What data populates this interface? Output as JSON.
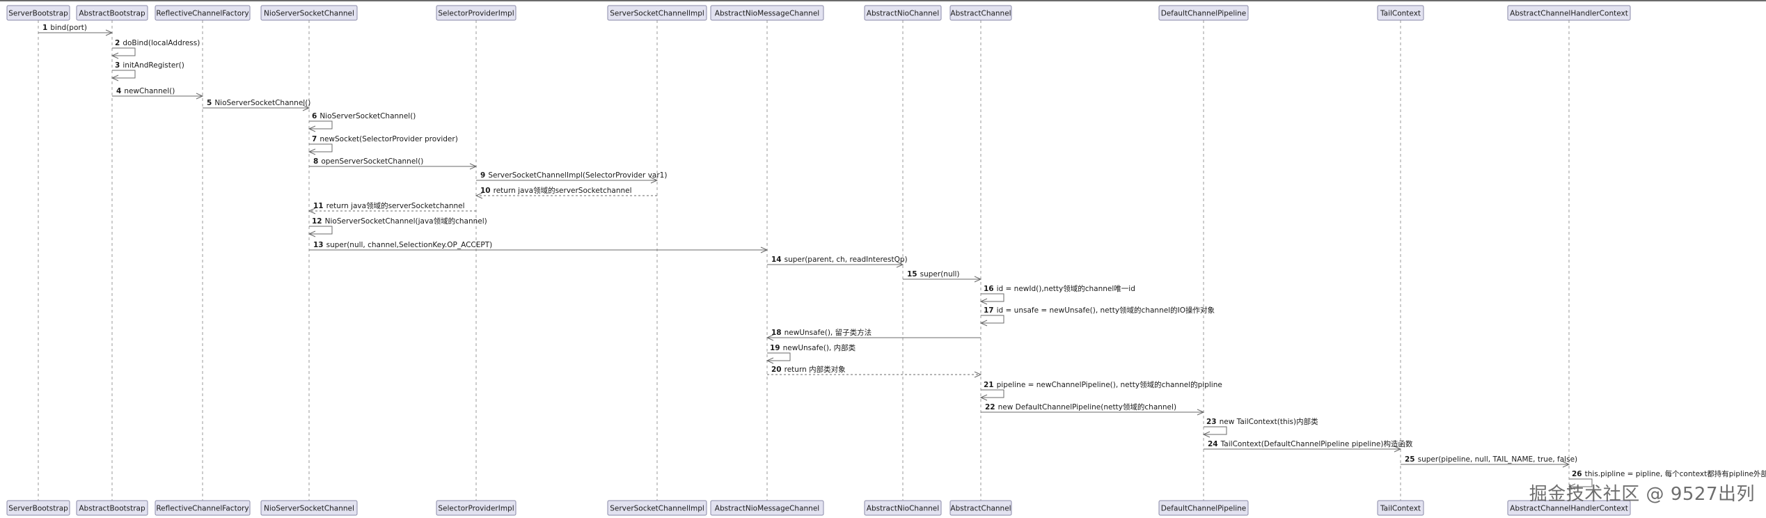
{
  "participants": [
    {
      "name": "ServerBootstrap"
    },
    {
      "name": "AbstractBootstrap"
    },
    {
      "name": "ReflectiveChannelFactory"
    },
    {
      "name": "NioServerSocketChannel"
    },
    {
      "name": "SelectorProviderImpl"
    },
    {
      "name": "ServerSocketChannelImpl"
    },
    {
      "name": "AbstractNioMessageChannel"
    },
    {
      "name": "AbstractNioChannel"
    },
    {
      "name": "AbstractChannel"
    },
    {
      "name": "DefaultChannelPipeline"
    },
    {
      "name": "TailContext"
    },
    {
      "name": "AbstractChannelHandlerContext"
    }
  ],
  "messages": [
    {
      "num": "1",
      "text": "bind(port)",
      "from": 0,
      "to": 1,
      "kind": "call"
    },
    {
      "num": "2",
      "text": "doBind(localAddress)",
      "from": 1,
      "to": 1,
      "kind": "self"
    },
    {
      "num": "3",
      "text": "initAndRegister()",
      "from": 1,
      "to": 1,
      "kind": "self"
    },
    {
      "num": "4",
      "text": "newChannel()",
      "from": 1,
      "to": 2,
      "kind": "call"
    },
    {
      "num": "5",
      "text": "NioServerSocketChannel()",
      "from": 2,
      "to": 3,
      "kind": "call"
    },
    {
      "num": "6",
      "text": "NioServerSocketChannel()",
      "from": 3,
      "to": 3,
      "kind": "self"
    },
    {
      "num": "7",
      "text": "newSocket(SelectorProvider provider)",
      "from": 3,
      "to": 3,
      "kind": "self"
    },
    {
      "num": "8",
      "text": "openServerSocketChannel()",
      "from": 3,
      "to": 4,
      "kind": "call"
    },
    {
      "num": "9",
      "text": "ServerSocketChannelImpl(SelectorProvider var1)",
      "from": 4,
      "to": 5,
      "kind": "call"
    },
    {
      "num": "10",
      "text": "return java领域的serverSocketchannel",
      "from": 5,
      "to": 4,
      "kind": "return"
    },
    {
      "num": "11",
      "text": "return java领域的serverSocketchannel",
      "from": 4,
      "to": 3,
      "kind": "return"
    },
    {
      "num": "12",
      "text": "NioServerSocketChannel(java领域的channel)",
      "from": 3,
      "to": 3,
      "kind": "self"
    },
    {
      "num": "13",
      "text": "super(null, channel,SelectionKey.OP_ACCEPT)",
      "from": 3,
      "to": 6,
      "kind": "call"
    },
    {
      "num": "14",
      "text": "super(parent, ch, readInterestOp)",
      "from": 6,
      "to": 7,
      "kind": "call"
    },
    {
      "num": "15",
      "text": "super(null)",
      "from": 7,
      "to": 8,
      "kind": "call"
    },
    {
      "num": "16",
      "text": "id = newId(),netty领域的channel唯一id",
      "from": 8,
      "to": 8,
      "kind": "self"
    },
    {
      "num": "17",
      "text": "id = unsafe = newUnsafe(), netty领域的channel的IO操作对象",
      "from": 8,
      "to": 8,
      "kind": "self"
    },
    {
      "num": "18",
      "text": "newUnsafe(), 留子类方法",
      "from": 8,
      "to": 6,
      "kind": "call"
    },
    {
      "num": "19",
      "text": "newUnsafe(), 内部类",
      "from": 6,
      "to": 6,
      "kind": "self"
    },
    {
      "num": "20",
      "text": "return 内部类对象",
      "from": 6,
      "to": 8,
      "kind": "return"
    },
    {
      "num": "21",
      "text": "pipeline = newChannelPipeline(), netty领域的channel的pipline",
      "from": 8,
      "to": 8,
      "kind": "self"
    },
    {
      "num": "22",
      "text": "new DefaultChannelPipeline(netty领域的channel)",
      "from": 8,
      "to": 9,
      "kind": "call"
    },
    {
      "num": "23",
      "text": "new TailContext(this)内部类",
      "from": 9,
      "to": 9,
      "kind": "self"
    },
    {
      "num": "24",
      "text": "TailContext(DefaultChannelPipeline pipeline)构造函数",
      "from": 9,
      "to": 10,
      "kind": "call"
    },
    {
      "num": "25",
      "text": "super(pipeline, null, TAIL_NAME, true, false)",
      "from": 10,
      "to": 11,
      "kind": "call"
    },
    {
      "num": "26",
      "text": "this.pipline = pipline, 每个context都持有pipline外部对象",
      "from": 11,
      "to": 11,
      "kind": "self"
    }
  ],
  "watermark": "掘金技术社区 @ 9527出列",
  "colors": {
    "box_fill": "#e2e2f0",
    "box_border": "#8a8aa8",
    "line": "#6a6a6a"
  }
}
